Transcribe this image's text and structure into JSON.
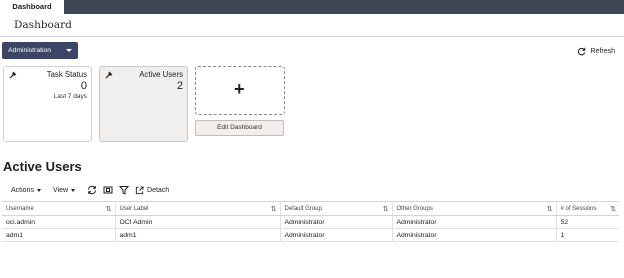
{
  "nav": {
    "active_tab": "Dashboard"
  },
  "page": {
    "title": "Dashboard"
  },
  "controls": {
    "context_select": "Administration",
    "refresh_label": "Refresh"
  },
  "tiles": [
    {
      "label": "Task Status",
      "count": "0",
      "sub": "Last 7 days"
    },
    {
      "label": "Active Users",
      "count": "2",
      "sub": ""
    }
  ],
  "edit_dashboard_label": "Edit Dashboard",
  "section": {
    "title": "Active Users"
  },
  "toolbar": {
    "actions": "Actions",
    "view": "View",
    "detach": "Detach"
  },
  "table": {
    "columns": [
      "Username",
      "User Label",
      "Default Group",
      "Other Groups",
      "# of Sessions"
    ],
    "rows": [
      [
        "oci.admin",
        "OCI Admin",
        "Administrator",
        "Administrator",
        "52"
      ],
      [
        "adm1",
        "adm1",
        "Administrator",
        "Administrator",
        "1"
      ]
    ]
  },
  "icons": {
    "tile_pin": "wrench-icon",
    "refresh": "refresh-icon",
    "sync": "sync-icon",
    "freeze": "freeze-columns-icon",
    "filter": "filter-icon",
    "detach": "detach-icon"
  },
  "colors": {
    "topbar": "#3f4555",
    "primary_button": "#3b4566",
    "selected_tile": "#f0efed"
  }
}
